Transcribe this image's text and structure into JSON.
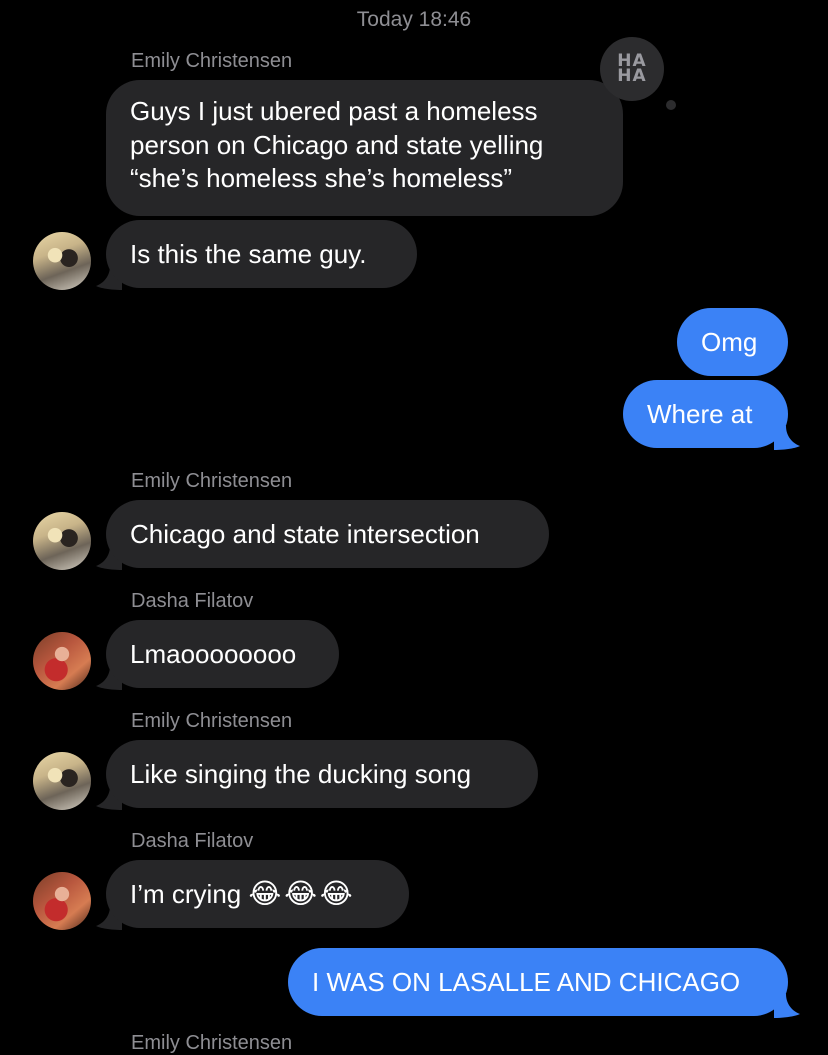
{
  "timestamp": "Today 18:46",
  "tapback_label": {
    "line1": "HA",
    "line2": "HA"
  },
  "messages": [
    {
      "sender": "Emily Christensen",
      "text_lines": [
        "Guys I just ubered past a homeless",
        "person on Chicago and state yelling",
        "“she’s homeless she’s homeless”"
      ],
      "direction": "incoming"
    },
    {
      "text": "Is this the same guy.",
      "direction": "incoming",
      "avatar": "Emily Christensen"
    },
    {
      "text": "Omg",
      "direction": "outgoing"
    },
    {
      "text": "Where at",
      "direction": "outgoing"
    },
    {
      "sender": "Emily Christensen",
      "text": "Chicago and state intersection",
      "direction": "incoming"
    },
    {
      "sender": "Dasha Filatov",
      "text": "Lmaoooooooo",
      "direction": "incoming"
    },
    {
      "sender": "Emily Christensen",
      "text": "Like singing the ducking song",
      "direction": "incoming"
    },
    {
      "sender": "Dasha Filatov",
      "text": "I’m crying",
      "emoji": "😂😂😂",
      "direction": "incoming"
    },
    {
      "text": "I WAS ON LASALLE AND CHICAGO",
      "direction": "outgoing"
    },
    {
      "sender": "Emily Christensen",
      "direction": "incoming"
    }
  ],
  "colors": {
    "incoming_bubble": "#262628",
    "outgoing_bubble": "#3b82f6",
    "background": "#000000",
    "meta_text": "#8e8e93"
  }
}
